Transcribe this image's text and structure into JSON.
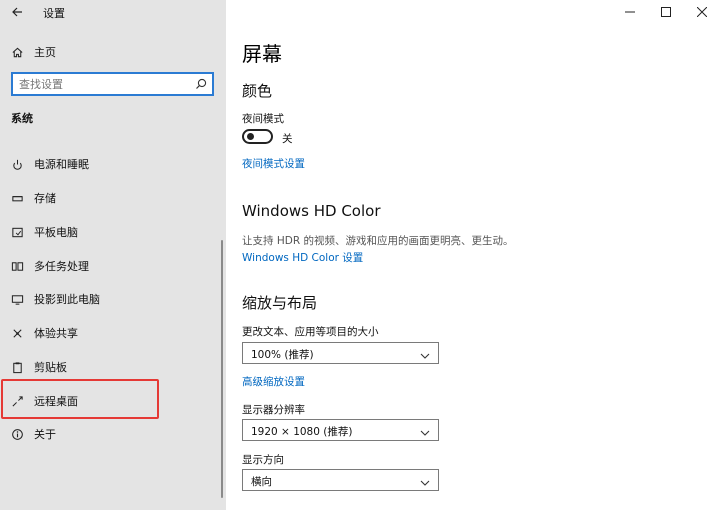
{
  "window": {
    "title": "设置",
    "controls": [
      "minimize",
      "maximize",
      "close"
    ]
  },
  "sidebar": {
    "home_label": "主页",
    "search_placeholder": "查找设置",
    "section_title": "系统",
    "items": [
      {
        "label": "电源和睡眠",
        "icon": "power-icon"
      },
      {
        "label": "存储",
        "icon": "storage-icon"
      },
      {
        "label": "平板电脑",
        "icon": "tablet-icon"
      },
      {
        "label": "多任务处理",
        "icon": "multitasking-icon"
      },
      {
        "label": "投影到此电脑",
        "icon": "project-icon"
      },
      {
        "label": "体验共享",
        "icon": "shared-experience-icon"
      },
      {
        "label": "剪贴板",
        "icon": "clipboard-icon"
      },
      {
        "label": "远程桌面",
        "icon": "remote-desktop-icon",
        "highlighted": true
      },
      {
        "label": "关于",
        "icon": "info-icon"
      }
    ]
  },
  "main": {
    "page_title": "屏幕",
    "color_section": {
      "title": "颜色",
      "night_mode_label": "夜间模式",
      "night_mode_state": "关",
      "night_mode_link": "夜间模式设置"
    },
    "hdr_section": {
      "title": "Windows HD Color",
      "description": "让支持 HDR 的视频、游戏和应用的画面更明亮、更生动。",
      "link": "Windows HD Color 设置"
    },
    "scale_section": {
      "title": "缩放与布局",
      "scale_label": "更改文本、应用等项目的大小",
      "scale_value": "100% (推荐)",
      "advanced_link": "高级缩放设置",
      "resolution_label": "显示器分辨率",
      "resolution_value": "1920 × 1080 (推荐)",
      "orientation_label": "显示方向",
      "orientation_value": "横向"
    }
  },
  "colors": {
    "sidebar_bg": "#e4e4e4",
    "accent": "#0067c0",
    "search_border": "#2b7bd3",
    "highlight": "#e53935"
  }
}
